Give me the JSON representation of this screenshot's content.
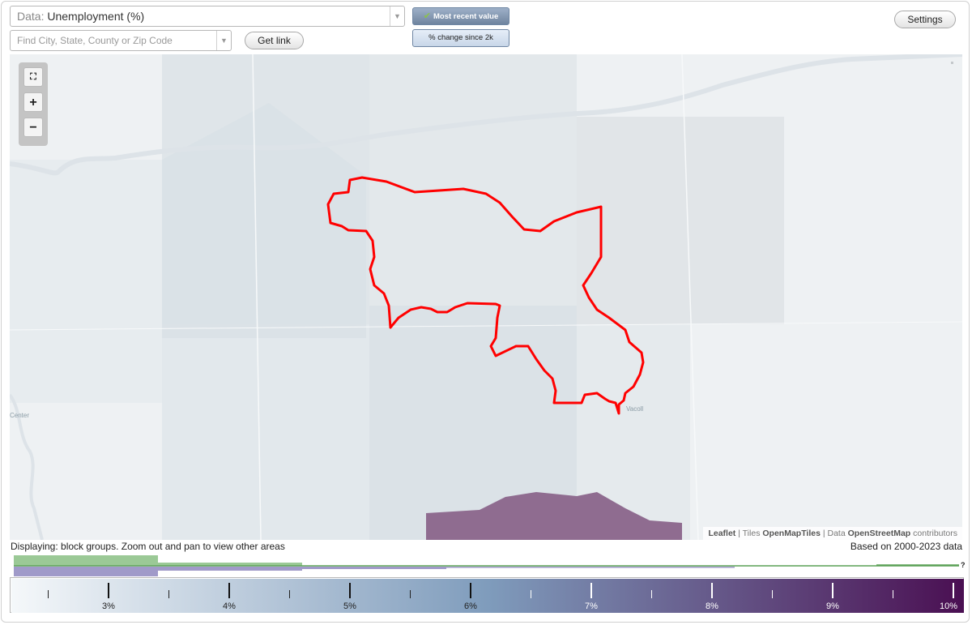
{
  "data_selector": {
    "prefix": "Data:",
    "value": "Unemployment (%)"
  },
  "search": {
    "placeholder": "Find City, State, County or Zip Code"
  },
  "buttons": {
    "get_link": "Get link",
    "settings": "Settings"
  },
  "toggles": {
    "most_recent": "Most recent value",
    "change_since": "% change since 2k"
  },
  "zoom": {
    "fullscreen": "⛶",
    "zoom_in": "+",
    "zoom_out": "−"
  },
  "map": {
    "place_labels": [
      "Center",
      "Vacoll"
    ],
    "attribution": {
      "leaflet": "Leaflet",
      "tiles_prefix": "| Tiles",
      "tiles": "OpenMapTiles",
      "data_prefix": "| Data",
      "data": "OpenStreetMap",
      "suffix": "contributors"
    },
    "highlight_color": "#ff0000"
  },
  "notes": {
    "displaying": "Displaying: block groups. Zoom out and pan to view other areas",
    "based_on": "Based on 2000-2023 data"
  },
  "histogram": {
    "unknown_marker": "?"
  },
  "legend": {
    "ticks": [
      "3%",
      "4%",
      "5%",
      "6%",
      "7%",
      "8%",
      "9%",
      "10%"
    ],
    "min_color": "#f5f8fa",
    "mid_color": "#7f9cbc",
    "max_color": "#4a0f52"
  }
}
